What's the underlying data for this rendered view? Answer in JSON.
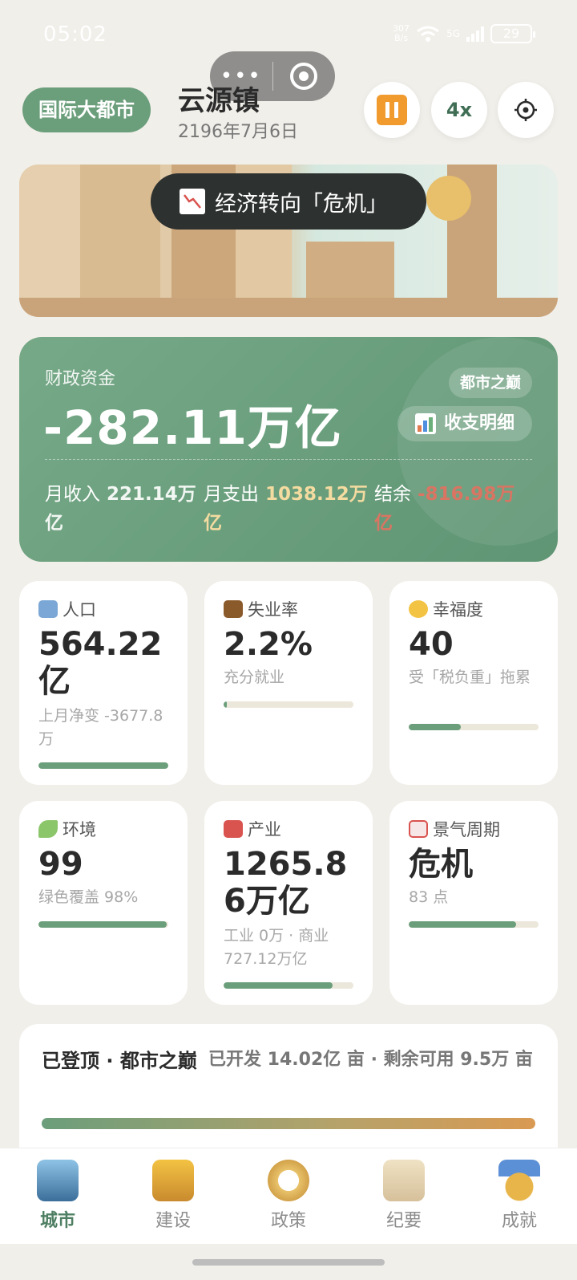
{
  "status_bar": {
    "time": "05:02",
    "net_speed_value": "307",
    "net_speed_unit": "B/s",
    "network": "5G",
    "battery": "29"
  },
  "header": {
    "level_badge": "国际大都市",
    "city_name": "云源镇",
    "date": "2196年7月6日",
    "speed": "4x",
    "capsule_dots": "•••"
  },
  "toast": {
    "text": "经济转向「危机」",
    "icon": "chart-decreasing-icon"
  },
  "finance": {
    "label": "财政资金",
    "amount": "-282.11万亿",
    "badge": "都市之巅",
    "detail_button": "收支明细",
    "income_label": "月收入",
    "income_value": "221.14万亿",
    "expense_label": "月支出",
    "expense_value": "1038.12万亿",
    "balance_label": "结余",
    "balance_value": "-816.98万亿",
    "colors": {
      "income": "#f2f7f3",
      "expense": "#f4dba0",
      "balance": "#d97562"
    }
  },
  "stats": [
    {
      "icon": "people-icon",
      "title": "人口",
      "value": "564.22亿",
      "sub": "上月净变 -3677.8万",
      "progress": 1.0
    },
    {
      "icon": "briefcase-icon",
      "title": "失业率",
      "value": "2.2%",
      "sub": "充分就业",
      "progress": 0.022
    },
    {
      "icon": "smile-icon",
      "title": "幸福度",
      "value": "40",
      "sub": "受「税负重」拖累",
      "progress": 0.4
    },
    {
      "icon": "leaf-icon",
      "title": "环境",
      "value": "99",
      "sub": "绿色覆盖 98%",
      "progress": 0.99
    },
    {
      "icon": "factory-icon",
      "title": "产业",
      "value": "1265.86万亿",
      "sub": "工业 0万 · 商业 727.12万亿",
      "progress": 0.84
    },
    {
      "icon": "chart-up-icon",
      "title": "景气周期",
      "value": "危机",
      "sub": "83 点",
      "progress": 0.83
    }
  ],
  "summit": {
    "title": "已登顶 · 都市之巅",
    "info": "已开发 14.02亿 亩 · 剩余可用 9.5万 亩",
    "progress": 0.99
  },
  "tabs": [
    {
      "label": "城市",
      "icon": "city-icon",
      "active": true
    },
    {
      "label": "建设",
      "icon": "crane-icon",
      "active": false
    },
    {
      "label": "政策",
      "icon": "compass-icon",
      "active": false
    },
    {
      "label": "纪要",
      "icon": "scroll-icon",
      "active": false
    },
    {
      "label": "成就",
      "icon": "medal-icon",
      "active": false
    }
  ]
}
